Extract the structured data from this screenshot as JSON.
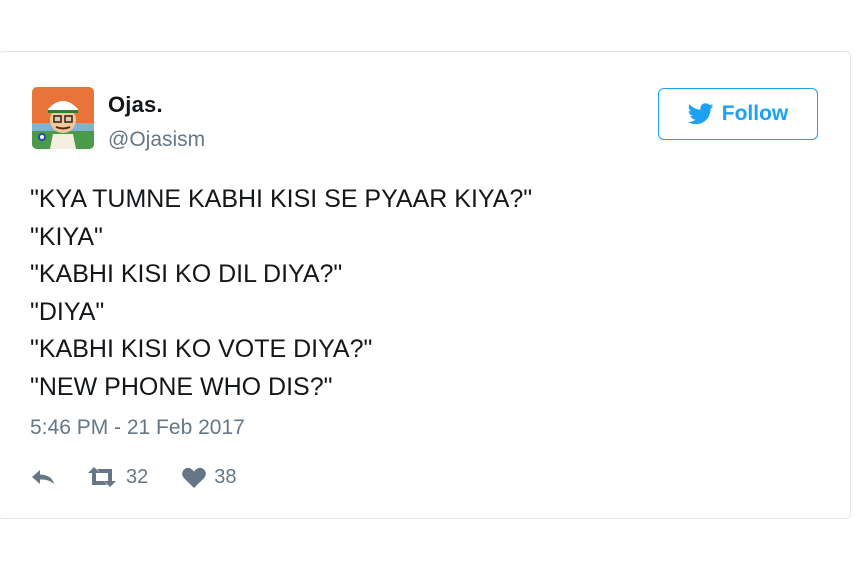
{
  "user": {
    "display_name": "Ojas.",
    "handle": "@Ojasism"
  },
  "follow_button": {
    "label": "Follow"
  },
  "tweet": {
    "lines": [
      "\"KYA TUMNE KABHI KISI SE PYAAR KIYA?\"",
      "\"KIYA\"",
      "\"KABHI KISI KO DIL DIYA?\"",
      "\"DIYA\"",
      "\"KABHI KISI KO VOTE DIYA?\"",
      "\"NEW PHONE WHO DIS?\""
    ],
    "timestamp": "5:46 PM - 21 Feb 2017"
  },
  "actions": {
    "reply_icon": "reply-icon",
    "retweet_icon": "retweet-icon",
    "retweet_count": "32",
    "like_icon": "heart-icon",
    "like_count": "38"
  },
  "colors": {
    "accent": "#1da1f2",
    "text": "#14171a",
    "muted": "#657786",
    "border": "#e1e8ed"
  }
}
